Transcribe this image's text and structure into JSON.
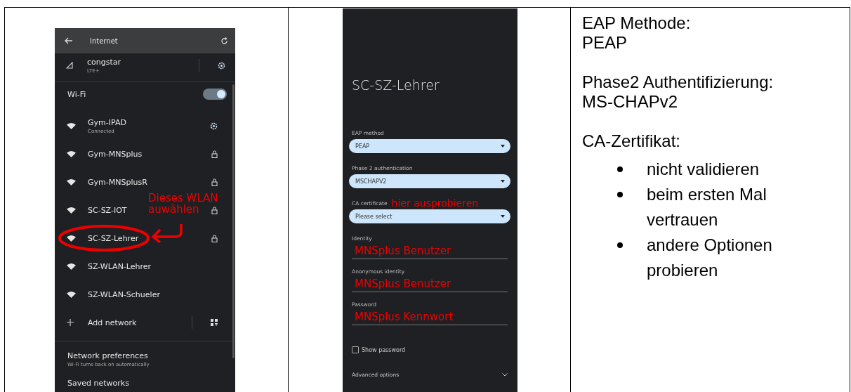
{
  "wifi_screen": {
    "title": "Internet",
    "mobile": {
      "name": "congstar",
      "subtitle": "LTE+"
    },
    "wifi_label": "Wi-Fi",
    "wifi_on": true,
    "networks": [
      {
        "name": "Gym-IPAD",
        "subtitle": "Connected",
        "has_settings": true,
        "locked": false,
        "circled": false
      },
      {
        "name": "Gym-MNSplus",
        "has_settings": false,
        "locked": true,
        "circled": false
      },
      {
        "name": "Gym-MNSplusR",
        "has_settings": false,
        "locked": true,
        "circled": false
      },
      {
        "name": "SC-SZ-IOT",
        "has_settings": false,
        "locked": true,
        "circled": false
      },
      {
        "name": "SC-SZ-Lehrer",
        "has_settings": false,
        "locked": true,
        "circled": true
      },
      {
        "name": "SZ-WLAN-Lehrer",
        "has_settings": false,
        "locked": false,
        "circled": false
      },
      {
        "name": "SZ-WLAN-Schueler",
        "has_settings": false,
        "locked": false,
        "circled": false
      }
    ],
    "add_network": "Add network",
    "preferences": {
      "title": "Network preferences",
      "subtitle": "Wi-Fi turns back on automatically"
    },
    "saved": {
      "title": "Saved networks"
    },
    "annotation": [
      "Dieses WLAN",
      "auwählen"
    ]
  },
  "config_screen": {
    "title": "SC-SZ-Lehrer",
    "fields": [
      {
        "kind": "dropdown",
        "label": "EAP method",
        "value": "PEAP"
      },
      {
        "kind": "dropdown",
        "label": "Phase 2 authentication",
        "value": "MSCHAPV2"
      },
      {
        "kind": "dropdown",
        "label": "CA certificate",
        "note": "hier ausprobieren",
        "placeholder": "Please select"
      },
      {
        "kind": "text",
        "label": "Identity",
        "value": "MNSplus Benutzer"
      },
      {
        "kind": "text",
        "label": "Anonymous identity",
        "value": "MNSplus Benutzer"
      },
      {
        "kind": "text",
        "label": "Password",
        "value": "MNSplus Kennwort"
      }
    ],
    "show_password": {
      "label": "Show password",
      "checked": false
    },
    "advanced": "Advanced options"
  },
  "notes": [
    {
      "kind": "text",
      "lines": [
        "EAP Methode:",
        "PEAP"
      ]
    },
    {
      "kind": "text",
      "lines": [
        "Phase2 Authentifizierung:",
        "MS-CHAPv2"
      ]
    },
    {
      "kind": "text",
      "lines": [
        "CA-Zertifikat:"
      ]
    },
    {
      "kind": "bullets",
      "items": [
        "nicht validieren",
        "beim ersten Mal vertrauen",
        "andere Optionen probieren"
      ]
    }
  ]
}
